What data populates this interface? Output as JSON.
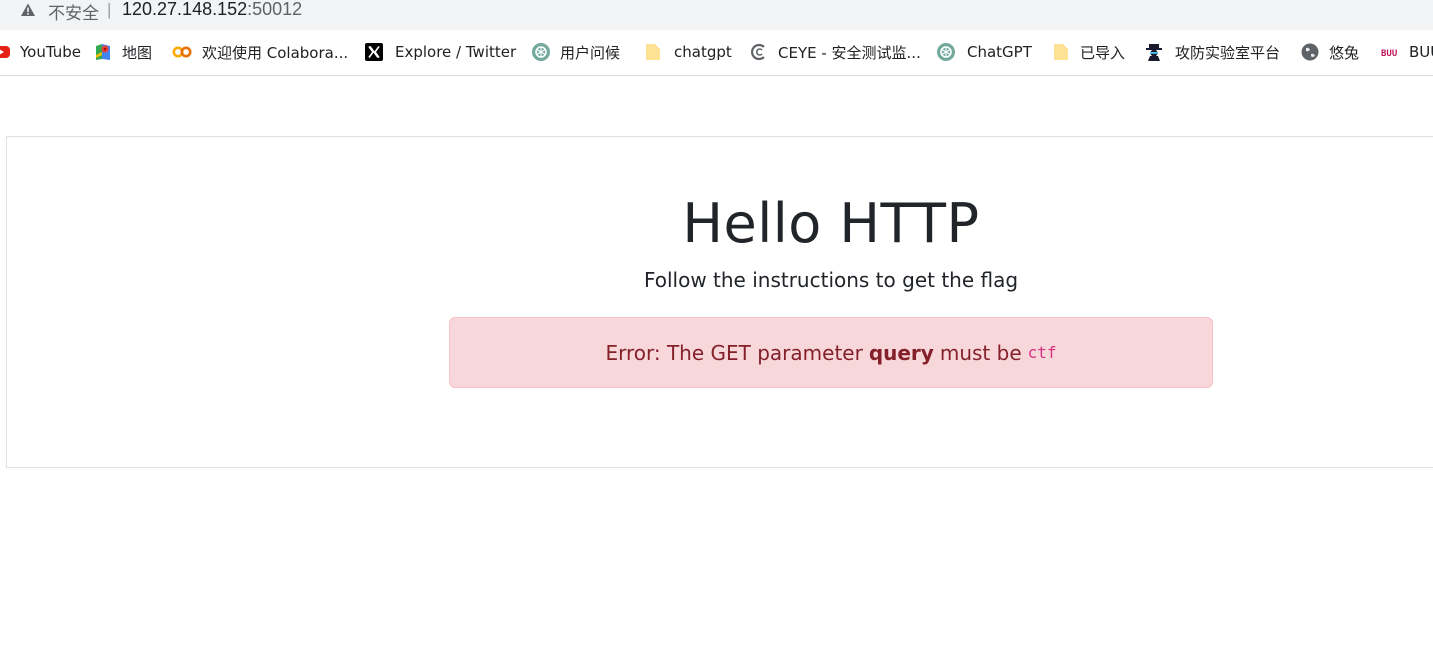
{
  "address_bar": {
    "security_label": "不安全",
    "separator": "|",
    "host": "120.27.148.152",
    "port": ":50012"
  },
  "bookmarks": [
    {
      "label": "YouTube",
      "icon": "youtube-icon"
    },
    {
      "label": "地图",
      "icon": "maps-icon"
    },
    {
      "label": "欢迎使用 Colabora...",
      "icon": "colab-icon"
    },
    {
      "label": "Explore / Twitter",
      "icon": "x-twitter-icon"
    },
    {
      "label": "用户问候",
      "icon": "openai-icon"
    },
    {
      "label": "chatgpt",
      "icon": "folder-icon"
    },
    {
      "label": "CEYE - 安全测试监...",
      "icon": "ceye-icon"
    },
    {
      "label": "ChatGPT",
      "icon": "openai-icon"
    },
    {
      "label": "已导入",
      "icon": "folder-icon"
    },
    {
      "label": "攻防实验室平台",
      "icon": "hacker-icon"
    },
    {
      "label": "悠兔",
      "icon": "globe-icon"
    },
    {
      "label": "BUU",
      "icon": "buu-icon"
    }
  ],
  "page": {
    "title": "Hello HTTP",
    "subtitle": "Follow the instructions to get the flag",
    "alert": {
      "prefix": "Error: The GET parameter",
      "param": "query",
      "middle": "must be",
      "value": "ctf"
    }
  },
  "colors": {
    "alert_bg": "#f8d7da",
    "alert_text": "#842029",
    "code_pink": "#d63384"
  }
}
